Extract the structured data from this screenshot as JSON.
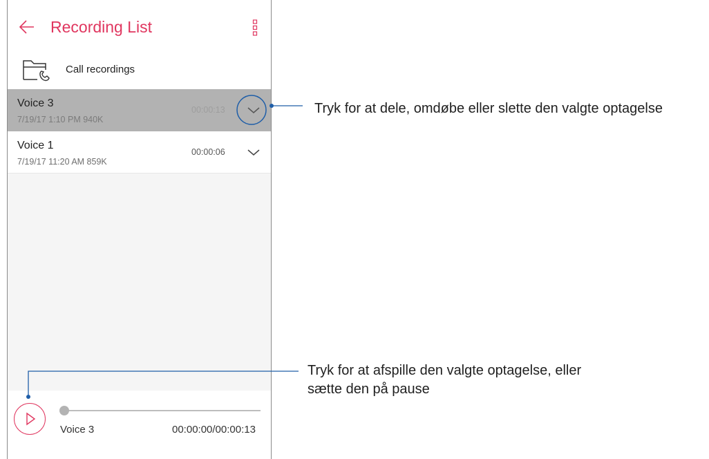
{
  "appbar": {
    "title": "Recording List",
    "back_icon": "arrow-left-icon",
    "menu_icon": "more-vert-icon",
    "accent": "#e0365f"
  },
  "folder": {
    "label": "Call recordings",
    "icon": "call-folder-icon"
  },
  "recordings": [
    {
      "name": "Voice 3",
      "meta": "7/19/17 1:10 PM   940K",
      "duration": "00:00:13",
      "selected": true
    },
    {
      "name": "Voice 1",
      "meta": "7/19/17 11:20 AM   859K",
      "duration": "00:00:06",
      "selected": false
    }
  ],
  "player": {
    "track_name": "Voice 3",
    "time": "00:00:00/00:00:13",
    "progress": 0
  },
  "callouts": {
    "options": "Tryk for at dele, omdøbe eller slette den valgte optagelse",
    "play_line1": "Tryk for at afspille den valgte optagelse, eller",
    "play_line2": "sætte den på pause"
  },
  "colors": {
    "callout_line": "#1f5ea8",
    "selected_row": "#b2b2b2"
  }
}
